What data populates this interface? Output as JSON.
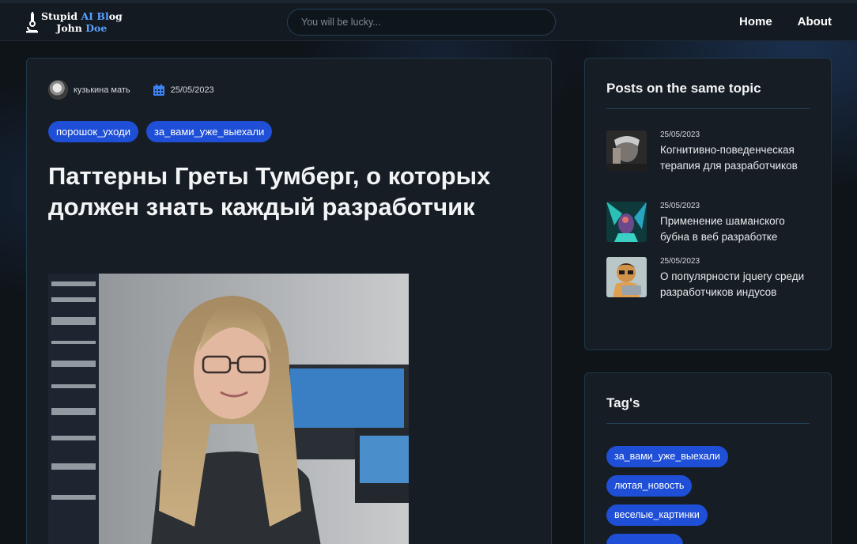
{
  "header": {
    "logo_line1_a": "Stupid ",
    "logo_line1_b": "AI Bl",
    "logo_line1_c": "og",
    "logo_line2_a": "John ",
    "logo_line2_b": "Doe",
    "search_placeholder": "You will be lucky...",
    "nav": [
      {
        "label": "Home"
      },
      {
        "label": "About"
      }
    ]
  },
  "article": {
    "author": "кузькина мать",
    "date": "25/05/2023",
    "tags": [
      "порошок_уходи",
      "за_вами_уже_выехали"
    ],
    "title": "Паттерны Греты Тумберг, о которых должен знать каждый разработчик"
  },
  "sidebar": {
    "related_title": "Posts on the same topic",
    "related_posts": [
      {
        "date": "25/05/2023",
        "title": "Когнитивно-поведенческая терапия для разработчиков"
      },
      {
        "date": "25/05/2023",
        "title": "Применение шаманского бубна в веб разработке"
      },
      {
        "date": "25/05/2023",
        "title": "О популярности jquery среди разработчиков индусов"
      }
    ],
    "tags_title": "Tag's",
    "tags": [
      "за_вами_уже_выехали",
      "лютая_новость",
      "веселые_картинки",
      ""
    ]
  },
  "colors": {
    "accent": "#1f4fd6",
    "background": "#0f1419",
    "card": "#161d24",
    "border": "#1e3a4a"
  }
}
